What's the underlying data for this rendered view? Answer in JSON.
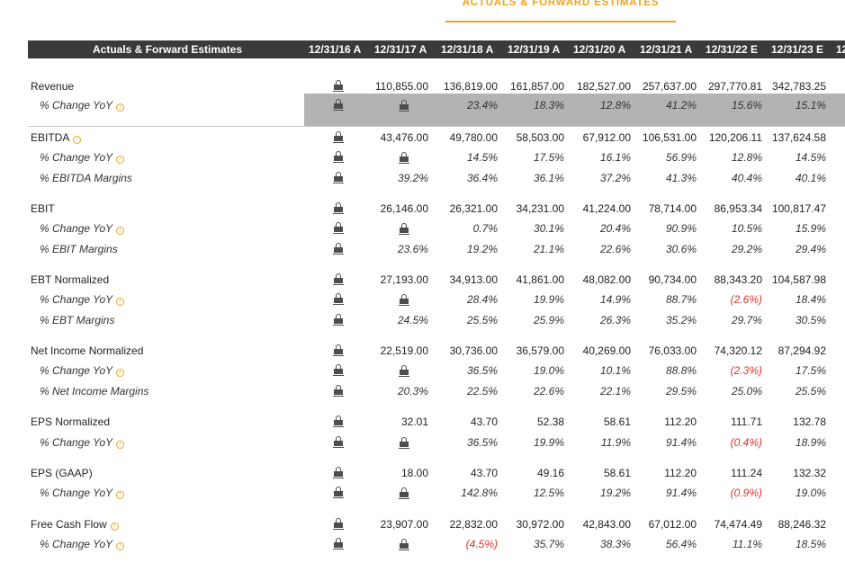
{
  "section_tab": "ACTUALS & FORWARD ESTIMATES",
  "table": {
    "header": {
      "title": "Actuals & Forward Estimates",
      "periods": [
        "12/31/16 A",
        "12/31/17 A",
        "12/31/18 A",
        "12/31/19 A",
        "12/31/20 A",
        "12/31/21 A",
        "12/31/22 E",
        "12/31/23 E",
        "12"
      ]
    },
    "rows": [
      {
        "label": "Revenue",
        "sub": false,
        "info": false,
        "values": [
          "110,855.00",
          "136,819.00",
          "161,857.00",
          "182,527.00",
          "257,637.00",
          "297,770.81",
          "342,783.25"
        ],
        "negatives": []
      },
      {
        "label": "% Change YoY",
        "sub": true,
        "info": true,
        "values": [
          "",
          "23.4%",
          "18.3%",
          "12.8%",
          "41.2%",
          "15.6%",
          "15.1%"
        ],
        "negatives": [],
        "locks": 2
      },
      {
        "label": "EBITDA",
        "sub": false,
        "info": true,
        "values": [
          "43,476.00",
          "49,780.00",
          "58,503.00",
          "67,912.00",
          "106,531.00",
          "120,206.11",
          "137,624.58"
        ],
        "negatives": []
      },
      {
        "label": "% Change YoY",
        "sub": true,
        "info": true,
        "values": [
          "",
          "14.5%",
          "17.5%",
          "16.1%",
          "56.9%",
          "12.8%",
          "14.5%"
        ],
        "negatives": [],
        "locks": 2
      },
      {
        "label": "% EBITDA Margins",
        "sub": true,
        "info": false,
        "values": [
          "39.2%",
          "36.4%",
          "36.1%",
          "37.2%",
          "41.3%",
          "40.4%",
          "40.1%"
        ],
        "negatives": []
      },
      {
        "label": "EBIT",
        "sub": false,
        "info": false,
        "values": [
          "26,146.00",
          "26,321.00",
          "34,231.00",
          "41,224.00",
          "78,714.00",
          "86,953.34",
          "100,817.47"
        ],
        "negatives": []
      },
      {
        "label": "% Change YoY",
        "sub": true,
        "info": true,
        "values": [
          "",
          "0.7%",
          "30.1%",
          "20.4%",
          "90.9%",
          "10.5%",
          "15.9%"
        ],
        "negatives": [],
        "locks": 2
      },
      {
        "label": "% EBIT Margins",
        "sub": true,
        "info": false,
        "values": [
          "23.6%",
          "19.2%",
          "21.1%",
          "22.6%",
          "30.6%",
          "29.2%",
          "29.4%"
        ],
        "negatives": []
      },
      {
        "label": "EBT Normalized",
        "sub": false,
        "info": false,
        "values": [
          "27,193.00",
          "34,913.00",
          "41,861.00",
          "48,082.00",
          "90,734.00",
          "88,343.20",
          "104,587.98"
        ],
        "negatives": []
      },
      {
        "label": "% Change YoY",
        "sub": true,
        "info": true,
        "values": [
          "",
          "28.4%",
          "19.9%",
          "14.9%",
          "88.7%",
          "(2.6%)",
          "18.4%"
        ],
        "negatives": [
          5
        ],
        "locks": 2
      },
      {
        "label": "% EBT Margins",
        "sub": true,
        "info": false,
        "values": [
          "24.5%",
          "25.5%",
          "25.9%",
          "26.3%",
          "35.2%",
          "29.7%",
          "30.5%"
        ],
        "negatives": []
      },
      {
        "label": "Net Income Normalized",
        "sub": false,
        "info": false,
        "values": [
          "22,519.00",
          "30,736.00",
          "36,579.00",
          "40,269.00",
          "76,033.00",
          "74,320.12",
          "87,294.92"
        ],
        "negatives": []
      },
      {
        "label": "% Change YoY",
        "sub": true,
        "info": true,
        "values": [
          "",
          "36.5%",
          "19.0%",
          "10.1%",
          "88.8%",
          "(2.3%)",
          "17.5%"
        ],
        "negatives": [
          5
        ],
        "locks": 2
      },
      {
        "label": "% Net Income Margins",
        "sub": true,
        "info": false,
        "values": [
          "20.3%",
          "22.5%",
          "22.6%",
          "22.1%",
          "29.5%",
          "25.0%",
          "25.5%"
        ],
        "negatives": []
      },
      {
        "label": "EPS Normalized",
        "sub": false,
        "info": false,
        "values": [
          "32.01",
          "43.70",
          "52.38",
          "58.61",
          "112.20",
          "111.71",
          "132.78"
        ],
        "negatives": []
      },
      {
        "label": "% Change YoY",
        "sub": true,
        "info": true,
        "values": [
          "",
          "36.5%",
          "19.9%",
          "11.9%",
          "91.4%",
          "(0.4%)",
          "18.9%"
        ],
        "negatives": [
          5
        ],
        "locks": 2
      },
      {
        "label": "EPS (GAAP)",
        "sub": false,
        "info": false,
        "values": [
          "18.00",
          "43.70",
          "49.16",
          "58.61",
          "112.20",
          "111.24",
          "132.32"
        ],
        "negatives": []
      },
      {
        "label": "% Change YoY",
        "sub": true,
        "info": true,
        "values": [
          "",
          "142.8%",
          "12.5%",
          "19.2%",
          "91.4%",
          "(0.9%)",
          "19.0%"
        ],
        "negatives": [
          5
        ],
        "locks": 2
      },
      {
        "label": "Free Cash Flow",
        "sub": false,
        "info": true,
        "values": [
          "23,907.00",
          "22,832.00",
          "30,972.00",
          "42,843.00",
          "67,012.00",
          "74,474.49",
          "88,246.32"
        ],
        "negatives": []
      },
      {
        "label": "% Change YoY",
        "sub": true,
        "info": true,
        "values": [
          "",
          "(4.5%)",
          "35.7%",
          "38.3%",
          "56.4%",
          "11.1%",
          "18.5%"
        ],
        "negatives": [
          1
        ],
        "locks": 2
      }
    ]
  },
  "colors": {
    "accent": "#f0a21e",
    "header_bg": "#3a3a3a",
    "negative": "#d9352b",
    "highlight_band": "#b3b3b3"
  },
  "icons": {
    "locked_cell": "lock-icon",
    "info": "info-icon"
  }
}
